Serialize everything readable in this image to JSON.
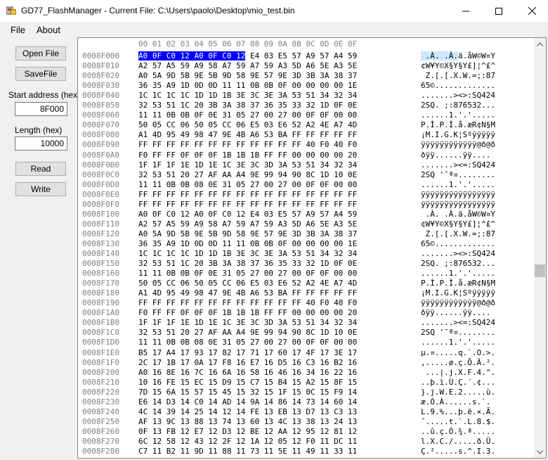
{
  "window": {
    "title": "GD77_FlashManager - Current File: C:\\Users\\paolo\\Desktop\\mio_test.bin"
  },
  "menu": {
    "file": "File",
    "about": "About"
  },
  "side": {
    "open_label": "Open File",
    "save_label": "SaveFile",
    "start_label": "Start address (hex)",
    "start_value": "8F000",
    "length_label": "Length (hex)",
    "length_value": "10000",
    "read_label": "Read",
    "write_label": "Write"
  },
  "hex": {
    "header": "00 01 02 03 04 05 06 07 08 09 0A 0B 0C 0D 0E 0F",
    "selection": {
      "row": 0,
      "hex": "A0 0F C0 12 A0 0F C0 12",
      "ascii": " À  .À "
    },
    "rows": [
      {
        "addr": "0008F000",
        "hex": "A0 0F C0 12 A0 0F C0 12 E4 03 E5 57 A9 57 A4 59",
        "ascii": " .À. .À.ä.åW©W¤Y"
      },
      {
        "addr": "0008F010",
        "hex": "A2 57 A5 59 A9 58 A7 59 A7 59 A3 5D A6 5E A3 5E",
        "ascii": "¢W¥Y©X§Y§Y£]¦^£^"
      },
      {
        "addr": "0008F020",
        "hex": "A0 5A 9D 5B 9E 5B 9D 58 9E 57 9E 3D 3B 3A 38 37",
        "ascii": " Z.[.[.X.W.=;:87"
      },
      {
        "addr": "0008F030",
        "hex": "36 35 A9 1D 0D 0D 11 11 0B 0B 0F 00 00 00 00 1E",
        "ascii": "65©............."
      },
      {
        "addr": "0008F040",
        "hex": "1C 1C 1C 1C 1D 1D 1B 3E 3C 3E 3A 53 51 34 32 34",
        "ascii": ".......><>:SQ424"
      },
      {
        "addr": "0008F050",
        "hex": "32 53 51 1C 20 3B 3A 38 37 36 35 33 32 1D 0F 0E",
        "ascii": "2SQ. ;:876532..."
      },
      {
        "addr": "0008F060",
        "hex": "11 11 0B 0B 0F 0E 31 05 27 00 27 00 0F 0F 00 00",
        "ascii": "......1.'.'....."
      },
      {
        "addr": "0008F070",
        "hex": "50 05 CC 06 50 05 CC 06 E5 03 E6 52 A2 4E A7 4D",
        "ascii": "P.Ì.P.Ì.å.æR¢N§M"
      },
      {
        "addr": "0008F080",
        "hex": "A1 4D 95 49 98 47 9E 4B A6 53 BA FF FF FF FF FF",
        "ascii": "¡M.I.G.K¦Sºÿÿÿÿÿ"
      },
      {
        "addr": "0008F090",
        "hex": "FF FF FF FF FF FF FF FF FF FF FF FF 40 F0 40 F0",
        "ascii": "ÿÿÿÿÿÿÿÿÿÿÿÿ@ð@ð"
      },
      {
        "addr": "0008F0A0",
        "hex": "F0 FF FF 0F 0F 0F 1B 1B 1B FF FF 00 00 00 00 20",
        "ascii": "ðÿÿ......ÿÿ.... "
      },
      {
        "addr": "0008F0B0",
        "hex": "1F 1F 1F 1E 1D 1E 1C 3E 3C 3D 3A 53 51 34 32 34",
        "ascii": ".......><=:SQ424"
      },
      {
        "addr": "0008F0C0",
        "hex": "32 53 51 20 27 AF AA A4 9E 99 94 90 8C 1D 10 0E",
        "ascii": "2SQ '¯ª¤........"
      },
      {
        "addr": "0008F0D0",
        "hex": "11 11 0B 0B 08 0E 31 05 27 00 27 00 0F 0F 00 00",
        "ascii": "......1.'.'....."
      },
      {
        "addr": "0008F0E0",
        "hex": "FF FF FF FF FF FF FF FF FF FF FF FF FF FF FF FF",
        "ascii": "ÿÿÿÿÿÿÿÿÿÿÿÿÿÿÿÿ"
      },
      {
        "addr": "0008F0F0",
        "hex": "FF FF FF FF FF FF FF FF FF FF FF FF FF FF FF FF",
        "ascii": "ÿÿÿÿÿÿÿÿÿÿÿÿÿÿÿÿ"
      },
      {
        "addr": "0008F100",
        "hex": "A0 0F C0 12 A0 0F C0 12 E4 03 E5 57 A9 57 A4 59",
        "ascii": " .À. .À.ä.åW©W¤Y"
      },
      {
        "addr": "0008F110",
        "hex": "A2 57 A5 59 A9 58 A7 59 A7 59 A3 5D A6 5E A3 5E",
        "ascii": "¢W¥Y©X§Y§Y£]¦^£^"
      },
      {
        "addr": "0008F120",
        "hex": "A0 5A 9D 5B 9E 5B 9D 58 9E 57 9E 3D 3B 3A 38 37",
        "ascii": " Z.[.[.X.W.=;:87"
      },
      {
        "addr": "0008F130",
        "hex": "36 35 A9 1D 0D 0D 11 11 0B 0B 0F 00 00 00 00 1E",
        "ascii": "65©............."
      },
      {
        "addr": "0008F140",
        "hex": "1C 1C 1C 1C 1D 1D 1B 3E 3C 3E 3A 53 51 34 32 34",
        "ascii": ".......><>:SQ424"
      },
      {
        "addr": "0008F150",
        "hex": "32 53 51 1C 20 3B 3A 38 37 36 35 33 32 1D 0F 0E",
        "ascii": "2SQ. ;:876532..."
      },
      {
        "addr": "0008F160",
        "hex": "11 11 0B 0B 0F 0E 31 05 27 00 27 00 0F 0F 00 00",
        "ascii": "......1.'.'....."
      },
      {
        "addr": "0008F170",
        "hex": "50 05 CC 06 50 05 CC 06 E5 03 E6 52 A2 4E A7 4D",
        "ascii": "P.Ì.P.Ì.å.æR¢N§M"
      },
      {
        "addr": "0008F180",
        "hex": "A1 4D 95 49 98 47 9E 4B A6 53 BA FF FF FF FF FF",
        "ascii": "¡M.I.G.K¦Sºÿÿÿÿÿ"
      },
      {
        "addr": "0008F190",
        "hex": "FF FF FF FF FF FF FF FF FF FF FF FF 40 F0 40 F0",
        "ascii": "ÿÿÿÿÿÿÿÿÿÿÿÿ@ð@ð"
      },
      {
        "addr": "0008F1A0",
        "hex": "F0 FF FF 0F 0F 0F 1B 1B 1B FF FF 00 00 00 00 20",
        "ascii": "ðÿÿ......ÿÿ.... "
      },
      {
        "addr": "0008F1B0",
        "hex": "1F 1F 1F 1E 1D 1E 1C 3E 3C 3D 3A 53 51 34 32 34",
        "ascii": ".......><=:SQ424"
      },
      {
        "addr": "0008F1C0",
        "hex": "32 53 51 20 27 AF AA A4 9E 99 94 90 8C 1D 10 0E",
        "ascii": "2SQ '¯ª¤........"
      },
      {
        "addr": "0008F1D0",
        "hex": "11 11 0B 0B 08 0E 31 05 27 00 27 00 0F 0F 00 00",
        "ascii": "......1.'.'....."
      },
      {
        "addr": "0008F1E0",
        "hex": "B5 17 A4 17 93 17 82 17 71 17 60 17 4F 17 3E 17",
        "ascii": "µ.¤.....q.`.O.>."
      },
      {
        "addr": "0008F1F0",
        "hex": "2C 17 1B 17 0A 17 F8 16 E7 16 D5 16 C3 16 B2 16",
        "ascii": ",.....ø.ç.Õ.Ã.².",
        "_": ""
      },
      {
        "addr": "0008F200",
        "hex": "A0 16 8E 16 7C 16 6A 16 58 16 46 16 34 16 22 16",
        "ascii": " ...|.j.X.F.4.\"."
      },
      {
        "addr": "0008F210",
        "hex": "10 16 FE 15 EC 15 D9 15 C7 15 B4 15 A2 15 8F 15",
        "ascii": "..þ.ì.Ù.Ç.´.¢..."
      },
      {
        "addr": "0008F220",
        "hex": "7D 15 6A 15 57 15 45 15 32 15 1F 15 0C 15 F9 14",
        "ascii": "}.j.W.E.2.....ù."
      },
      {
        "addr": "0008F230",
        "hex": "E6 14 D3 14 C0 14 AD 14 9A 14 86 14 73 14 60 14",
        "ascii": "æ.Ó.À.­.....s.`."
      },
      {
        "addr": "0008F240",
        "hex": "4C 14 39 14 25 14 12 14 FE 13 EB 13 D7 13 C3 13",
        "ascii": "L.9.%...þ.ë.×.Ã."
      },
      {
        "addr": "0008F250",
        "hex": "AF 13 9C 13 88 13 74 13 60 13 4C 13 38 13 24 13",
        "ascii": "¯.....t.`.L.8.$."
      },
      {
        "addr": "0008F260",
        "hex": "0F 13 FB 12 E7 12 D3 12 BE 12 AA 12 95 12 81 12",
        "ascii": "..û.ç.Ó.¾.ª....."
      },
      {
        "addr": "0008F270",
        "hex": "6C 12 58 12 43 12 2F 12 1A 12 05 12 F0 11 DC 11",
        "ascii": "l.X.C./.....ð.Ü."
      },
      {
        "addr": "0008F280",
        "hex": "C7 11 B2 11 9D 11 88 11 73 11 5E 11 49 11 33 11",
        "ascii": "Ç.².....s.^.I.3."
      }
    ]
  }
}
